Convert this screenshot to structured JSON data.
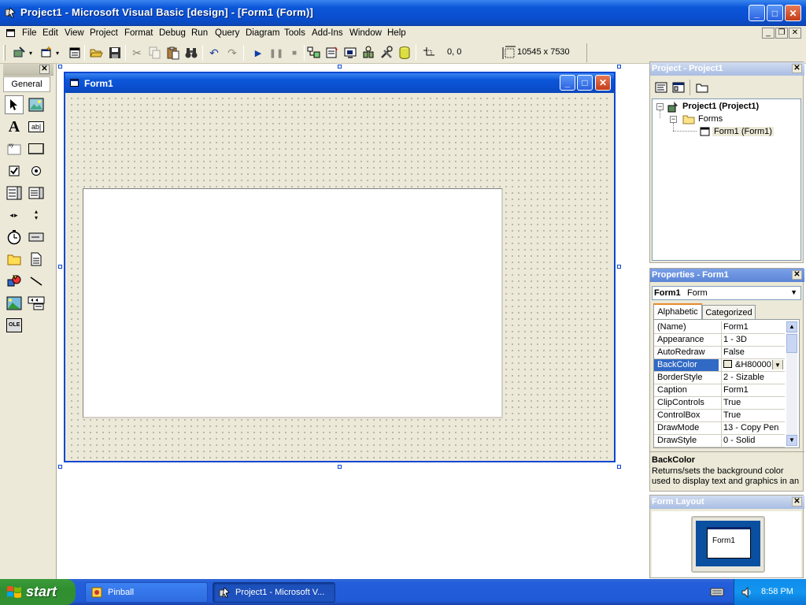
{
  "window": {
    "title": "Project1 - Microsoft Visual Basic [design] - [Form1 (Form)]",
    "minimize_label": "_",
    "maximize_label": "□",
    "close_label": "✕"
  },
  "menu": {
    "items": [
      "File",
      "Edit",
      "View",
      "Project",
      "Format",
      "Debug",
      "Run",
      "Query",
      "Diagram",
      "Tools",
      "Add-Ins",
      "Window",
      "Help"
    ]
  },
  "toolbar": {
    "position": "0, 0",
    "size": "10545 x 7530"
  },
  "toolbox": {
    "tab_label": "General",
    "close_label": "✕",
    "tools": [
      "pointer",
      "picturebox",
      "label",
      "textbox",
      "frame",
      "commandbutton",
      "checkbox",
      "optionbutton",
      "combobox",
      "listbox",
      "hscrollbar",
      "vscrollbar",
      "timer",
      "drivelistbox",
      "dirlistbox",
      "filelistbox",
      "shape",
      "line",
      "image",
      "data",
      "ole"
    ],
    "ole_label": "OLE",
    "textbox_label": "ab|"
  },
  "form": {
    "title": "Form1"
  },
  "project_panel": {
    "title": "Project - Project1",
    "tree": {
      "root": "Project1 (Project1)",
      "folder": "Forms",
      "item": "Form1 (Form1)"
    }
  },
  "properties_panel": {
    "title": "Properties - Form1",
    "object_name": "Form1",
    "object_type": "Form",
    "tabs": [
      "Alphabetic",
      "Categorized"
    ],
    "rows": [
      {
        "name": "(Name)",
        "value": "Form1"
      },
      {
        "name": "Appearance",
        "value": "1 - 3D"
      },
      {
        "name": "AutoRedraw",
        "value": "False"
      },
      {
        "name": "BackColor",
        "value": "&H80000"
      },
      {
        "name": "BorderStyle",
        "value": "2 - Sizable"
      },
      {
        "name": "Caption",
        "value": "Form1"
      },
      {
        "name": "ClipControls",
        "value": "True"
      },
      {
        "name": "ControlBox",
        "value": "True"
      },
      {
        "name": "DrawMode",
        "value": "13 - Copy Pen"
      },
      {
        "name": "DrawStyle",
        "value": "0 - Solid"
      }
    ],
    "selected_row": "BackColor",
    "desc_title": "BackColor",
    "desc_text": "Returns/sets the background color used to display text and graphics in an"
  },
  "layout_panel": {
    "title": "Form Layout",
    "preview_label": "Form1"
  },
  "taskbar": {
    "start_label": "start",
    "items": [
      "Pinball",
      "Project1 - Microsoft V..."
    ],
    "clock": "8:58 PM"
  },
  "colors": {
    "xp_blue": "#0b56d8",
    "face": "#ece9d8",
    "selection": "#316ac5",
    "start_green": "#3c9b3c"
  }
}
